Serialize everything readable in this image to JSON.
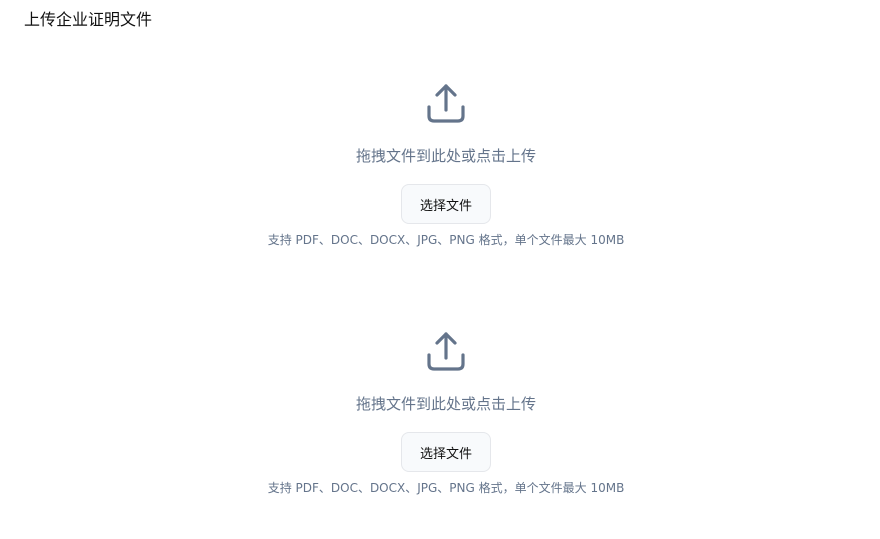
{
  "page": {
    "title": "上传企业证明文件"
  },
  "uploads": [
    {
      "drag_text": "拖拽文件到此处或点击上传",
      "button_label": "选择文件",
      "hint": "支持 PDF、DOC、DOCX、JPG、PNG 格式，单个文件最大 10MB",
      "icon": "upload-icon"
    },
    {
      "drag_text": "拖拽文件到此处或点击上传",
      "button_label": "选择文件",
      "hint": "支持 PDF、DOC、DOCX、JPG、PNG 格式，单个文件最大 10MB",
      "icon": "upload-icon"
    }
  ],
  "colors": {
    "icon": "#64748b",
    "muted_text": "#64748b",
    "button_bg": "#f8fafc",
    "button_border": "#e5e7eb"
  }
}
